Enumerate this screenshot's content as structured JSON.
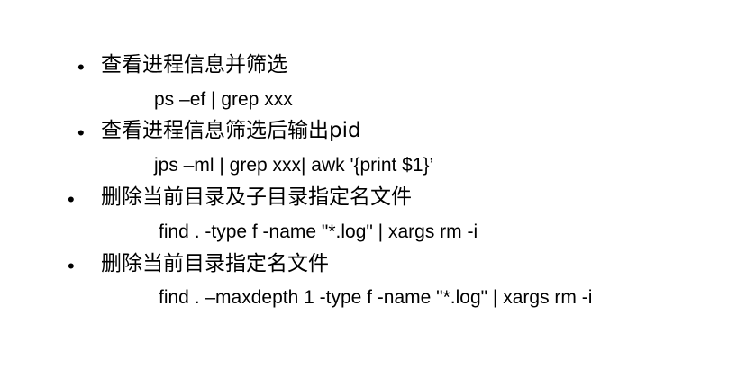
{
  "items": [
    {
      "bullet": "•",
      "heading": "查看进程信息并筛选",
      "command": "ps –ef | grep xxx"
    },
    {
      "bullet": "•",
      "heading": "查看进程信息筛选后输出pid",
      "command": "jps –ml | grep xxx| awk '{print $1}’"
    },
    {
      "bullet": "•",
      "heading": "删除当前目录及子目录指定名文件",
      "command": "find . -type f -name \"*.log\" | xargs rm -i"
    },
    {
      "bullet": "•",
      "heading": "删除当前目录指定名文件",
      "command": "find . –maxdepth 1 -type f -name \"*.log\" | xargs rm -i"
    }
  ]
}
